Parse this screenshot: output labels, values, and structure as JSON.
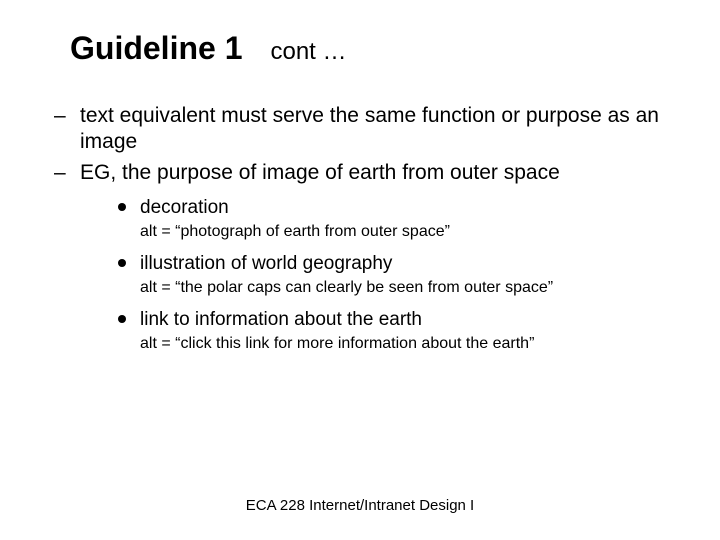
{
  "title": {
    "main": "Guideline 1",
    "sub": "cont …"
  },
  "bullets": {
    "b1": "text equivalent must serve the same function or purpose as an image",
    "b2": "EG, the purpose of image of earth from outer space"
  },
  "items": {
    "i1": {
      "label": "decoration",
      "alt": "alt = “photograph of earth from outer space”"
    },
    "i2": {
      "label": "illustration of world geography",
      "alt": "alt = “the polar caps can clearly be seen from outer space”"
    },
    "i3": {
      "label": "link to information about the earth",
      "alt": "alt = “click this link for more information about the earth”"
    }
  },
  "footer": "ECA 228  Internet/Intranet Design I"
}
